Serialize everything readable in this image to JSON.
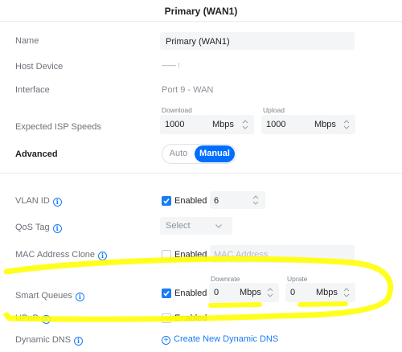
{
  "header": {
    "title": "Primary (WAN1)"
  },
  "name": {
    "label": "Name",
    "value": "Primary (WAN1)"
  },
  "host_device": {
    "label": "Host Device",
    "value": "—— ⧙"
  },
  "interface": {
    "label": "Interface",
    "value": "Port 9 - WAN"
  },
  "isp": {
    "label": "Expected ISP Speeds",
    "download_label": "Download",
    "download_value": "1000",
    "upload_label": "Upload",
    "upload_value": "1000",
    "unit": "Mbps"
  },
  "advanced": {
    "label": "Advanced",
    "options": [
      "Auto",
      "Manual"
    ],
    "selected": "Manual"
  },
  "vlan": {
    "label": "VLAN ID",
    "checkbox_label": "Enabled",
    "checked": true,
    "value": "6"
  },
  "qos": {
    "label": "QoS Tag",
    "placeholder": "Select"
  },
  "mac_clone": {
    "label": "MAC Address Clone",
    "checkbox_label": "Enabled",
    "checked": false,
    "placeholder": "MAC Address"
  },
  "smart_queues": {
    "label": "Smart Queues",
    "checkbox_label": "Enabled",
    "checked": true,
    "downrate_label": "Downrate",
    "downrate_value": "0",
    "uprate_label": "Uprate",
    "uprate_value": "0",
    "unit": "Mbps"
  },
  "upnp": {
    "label": "UPnP",
    "checkbox_label": "Enabled",
    "checked": false
  },
  "dynamic_dns": {
    "label": "Dynamic DNS",
    "link_label": "Create New Dynamic DNS"
  },
  "info_glyph": "i",
  "plus_glyph": "+",
  "colors": {
    "accent": "#006fff",
    "highlight": "#ffff00"
  }
}
